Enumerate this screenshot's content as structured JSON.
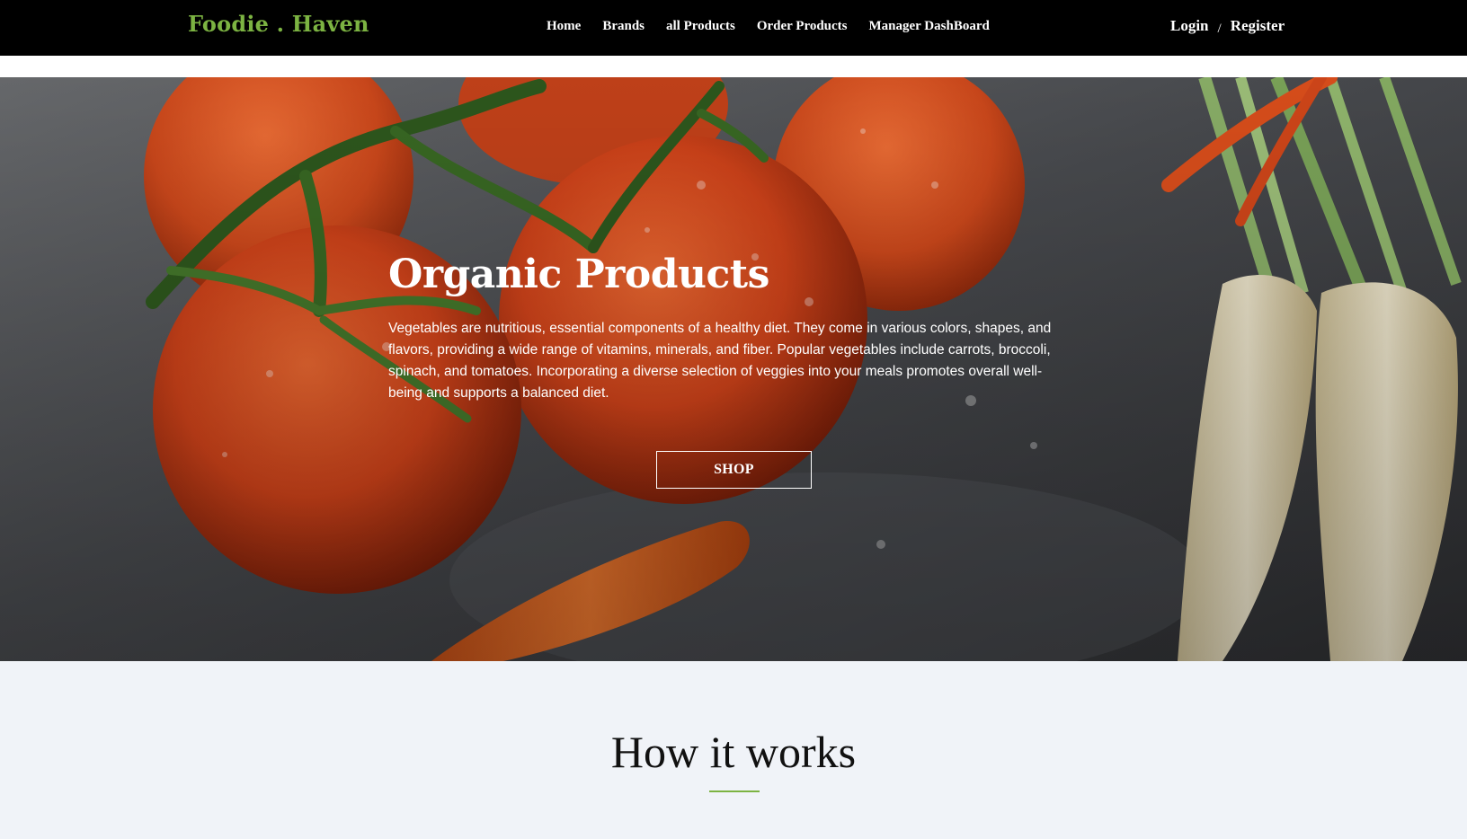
{
  "navbar": {
    "brand": "Foodie . Haven",
    "links": [
      "Home",
      "Brands",
      "all Products",
      "Order Products",
      "Manager DashBoard"
    ],
    "login": "Login",
    "separator": "/",
    "register": "Register"
  },
  "hero": {
    "title": "Organic Products",
    "description": "Vegetables are nutritious, essential components of a healthy diet. They come in various colors, shapes, and flavors, providing a wide range of vitamins, minerals, and fiber. Popular vegetables include carrots, broccoli, spinach, and tomatoes. Incorporating a diverse selection of veggies into your meals promotes overall well-being and supports a balanced diet.",
    "button_label": "SHOP",
    "image_icon": "vegetables-photo"
  },
  "how_it_works": {
    "title": "How it works"
  },
  "colors": {
    "brand_green": "#7cb342",
    "navbar_bg": "#000000",
    "section_bg": "#f0f3f8"
  }
}
